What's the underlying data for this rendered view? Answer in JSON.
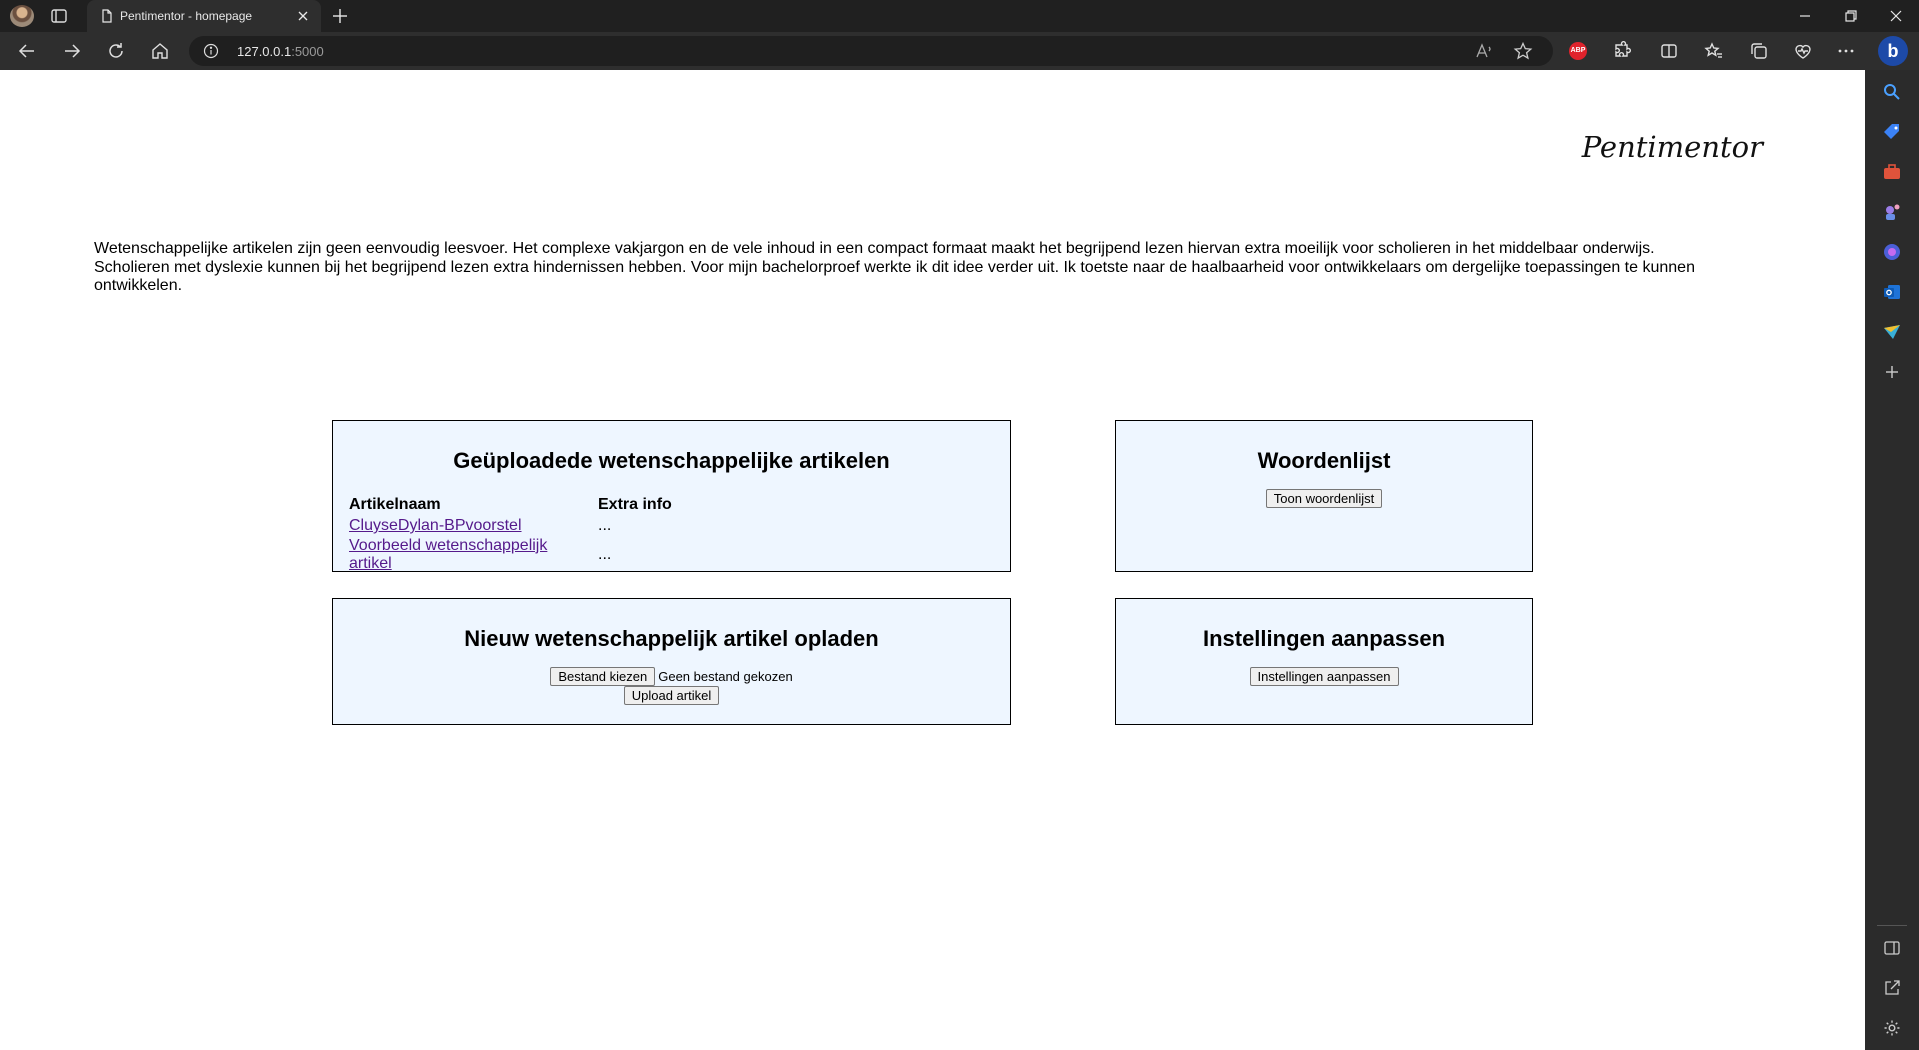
{
  "browser": {
    "tab_title": "Pentimentor - homepage",
    "url_host": "127.0.0.1",
    "url_port": ":5000",
    "abp_label": "ABP",
    "bing_label": "b"
  },
  "site": {
    "title": "Pentimentor",
    "intro": "Wetenschappelijke artikelen zijn geen eenvoudig leesvoer. Het complexe vakjargon en de vele inhoud in een compact formaat maakt het begrijpend lezen hiervan extra moeilijk voor scholieren in het middelbaar onderwijs. Scholieren met dyslexie kunnen bij het begrijpend lezen extra hindernissen hebben. Voor mijn bachelorproef werkte ik dit idee verder uit. Ik toetste naar de haalbaarheid voor ontwikkelaars om dergelijke toepassingen te kunnen ontwikkelen."
  },
  "articles_card": {
    "title": "Geüploadede wetenschappelijke artikelen",
    "columns": [
      "Artikelnaam",
      "Extra info"
    ],
    "rows": [
      {
        "name": "CluyseDylan-BPvoorstel",
        "info": "..."
      },
      {
        "name": "Voorbeeld wetenschappelijk artikel",
        "info": "..."
      }
    ]
  },
  "words_card": {
    "title": "Woordenlijst",
    "button": "Toon woordenlijst"
  },
  "upload_card": {
    "title": "Nieuw wetenschappelijk artikel opladen",
    "file_button": "Bestand kiezen",
    "no_file": "Geen bestand gekozen",
    "upload_button": "Upload artikel"
  },
  "settings_card": {
    "title": "Instellingen aanpassen",
    "button": "Instellingen aanpassen"
  },
  "colors": {
    "card_bg": "#eef6ff",
    "link_visited": "#551a8b",
    "chrome_dark": "#202020"
  }
}
